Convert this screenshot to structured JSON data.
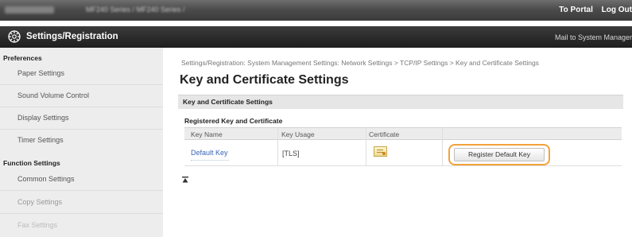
{
  "header": {
    "model_text": "MF240 Series / MF240 Series /",
    "links": [
      "To Portal",
      "Log Out"
    ]
  },
  "titlebar": {
    "icon": "settings-gear-icon",
    "title": "Settings/Registration",
    "mail_link": "Mail to System Manager"
  },
  "sidebar": {
    "preferences_heading": "Preferences",
    "preferences_items": [
      "Paper Settings",
      "Sound Volume Control",
      "Display Settings",
      "Timer Settings"
    ],
    "function_heading": "Function Settings",
    "function_items": [
      "Common Settings",
      "Copy Settings",
      "Fax Settings"
    ]
  },
  "breadcrumb": "Settings/Registration: System Management Settings: Network Settings > TCP/IP Settings > Key and Certificate Settings",
  "page_title": "Key and Certificate Settings",
  "section_title": "Key and Certificate Settings",
  "table": {
    "title": "Registered Key and Certificate",
    "headers": [
      "Key Name",
      "Key Usage",
      "Certificate"
    ],
    "rows": [
      {
        "key_name": "Default Key",
        "key_usage": "[TLS]",
        "certificate_icon": "certificate-icon"
      }
    ]
  },
  "register_button": "Register Default Key",
  "colors": {
    "highlight": "#f2a23c",
    "link": "#3a64b6",
    "titlebar": "#2a2a2a"
  }
}
